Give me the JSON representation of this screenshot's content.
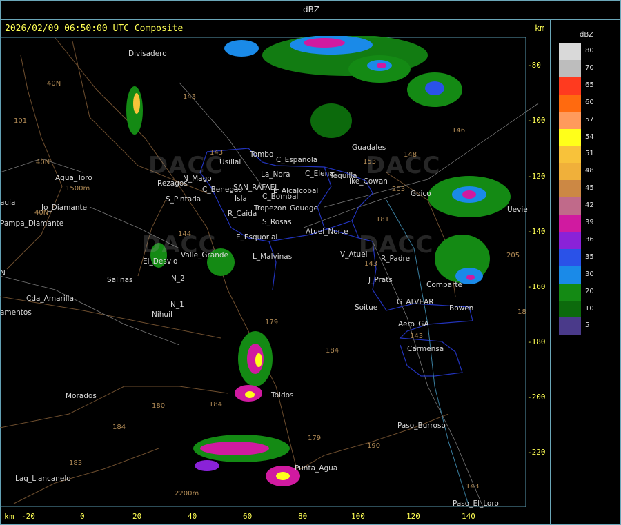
{
  "header": {
    "title": "dBZ"
  },
  "map": {
    "timestamp": "2026/02/09 06:50:00 UTC Composite",
    "km_label_top": "km",
    "km_label_bottom": "km",
    "x_ticks": [
      "-20",
      "0",
      "20",
      "40",
      "60",
      "80",
      "100",
      "120",
      "140"
    ],
    "y_ticks": [
      "-80",
      "-100",
      "-120",
      "-140",
      "-160",
      "-180",
      "-200",
      "-220"
    ],
    "watermark": "DACC",
    "places": [
      "Divisadero",
      "Agua_Toro",
      "Jo_Diamante",
      "Pampa_Diamante",
      "S_Pintada",
      "Rezagos",
      "N_Mago",
      "Usillal",
      "Tombo",
      "C_Española",
      "La_Nora",
      "C_Elena",
      "Tequilla",
      "Ike_Cowan",
      "Guadales",
      "Goico",
      "C_Benegas",
      "SAN_RAFAEL",
      "E_Alcalcobal",
      "Isla",
      "C_Bombal",
      "Tropezon",
      "Goudge",
      "R_Caida",
      "S_Rosas",
      "Atuel_Norte",
      "E_Esquorial",
      "Valle_Grande",
      "L_Malvinas",
      "V_Atuel",
      "R_Padre",
      "El_Desvio",
      "N_2",
      "Salinas",
      "Cda_Amarilla",
      "amentos",
      "N_1",
      "Nihuil",
      "J_Prats",
      "G_ALVEAR",
      "Soitue",
      "Bowen",
      "Comparte",
      "Aero_GA",
      "Carmensa",
      "Toldos",
      "Morados",
      "Paso_Burroso",
      "Punta_Agua",
      "Lag_Llancanelo",
      "Paso_El_Loro",
      "auia",
      "Uevie",
      "N"
    ],
    "routes": [
      "40N",
      "40N",
      "40N",
      "143",
      "143",
      "101",
      "146",
      "148",
      "153",
      "203",
      "144",
      "143",
      "181",
      "179",
      "184",
      "180",
      "184",
      "184",
      "183",
      "179",
      "190",
      "143",
      "143",
      "205",
      "18"
    ],
    "elevation_labels": [
      "1500m",
      "2200m"
    ]
  },
  "legend": {
    "unit": "dBZ",
    "items": [
      {
        "value": "80",
        "color": "#d9d9d9"
      },
      {
        "value": "70",
        "color": "#bdbdbd"
      },
      {
        "value": "65",
        "color": "#ff3a1f"
      },
      {
        "value": "60",
        "color": "#ff6a0f"
      },
      {
        "value": "57",
        "color": "#ff9a5c"
      },
      {
        "value": "54",
        "color": "#ffff1a"
      },
      {
        "value": "51",
        "color": "#f8c23a"
      },
      {
        "value": "48",
        "color": "#f0b03a"
      },
      {
        "value": "45",
        "color": "#cc8844"
      },
      {
        "value": "42",
        "color": "#c06a8a"
      },
      {
        "value": "39",
        "color": "#d01aa0"
      },
      {
        "value": "36",
        "color": "#8a22d8"
      },
      {
        "value": "35",
        "color": "#2a52e8"
      },
      {
        "value": "30",
        "color": "#1a8ae8"
      },
      {
        "value": "20",
        "color": "#148a14"
      },
      {
        "value": "10",
        "color": "#0c6a0c"
      },
      {
        "value": "5",
        "color": "#4a3a8a"
      }
    ]
  }
}
